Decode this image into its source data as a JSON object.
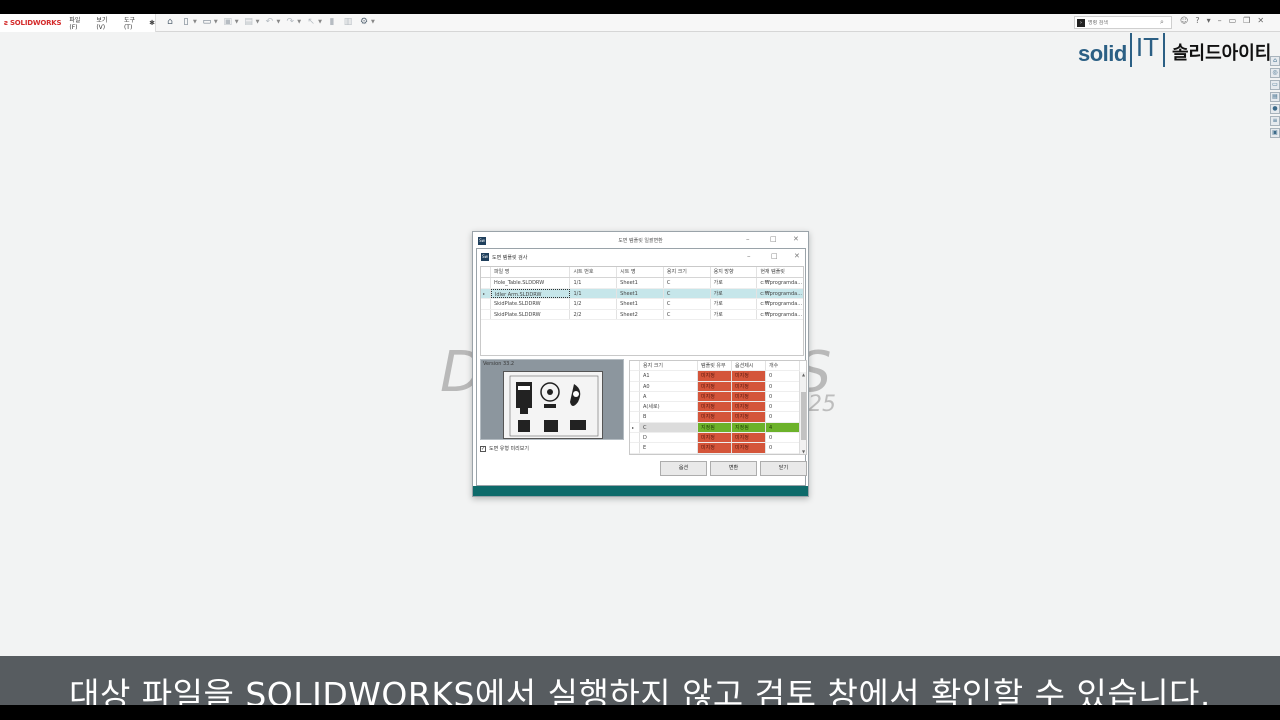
{
  "app": {
    "logo_text": "SOLIDWORKS",
    "menus": [
      "파일(F)",
      "보기(V)",
      "도구(T)"
    ],
    "search_placeholder": "명령 검색"
  },
  "brand": {
    "solid": "solid",
    "it": "IT",
    "korean": "솔리드아이티"
  },
  "background": {
    "mark_left": "D",
    "mark_right": "S",
    "year": "25"
  },
  "outer_dialog": {
    "title": "도면 템플릿 일괄변환"
  },
  "inner_dialog": {
    "title": "도면 템플릿 검사",
    "columns": [
      "파일 명",
      "시트 번호",
      "시트 명",
      "용지 크기",
      "용지 방향",
      "현재 템플릿"
    ],
    "rows": [
      [
        "Hole_Table.SLDDRW",
        "1/1",
        "Sheet1",
        "C",
        "가로",
        "c:₩programda..."
      ],
      [
        "Idler Arm.SLDDRW",
        "1/1",
        "Sheet1",
        "C",
        "가로",
        "c:₩programda..."
      ],
      [
        "SkidPlate.SLDDRW",
        "1/2",
        "Sheet1",
        "C",
        "가로",
        "c:₩programda..."
      ],
      [
        "SkidPlate.SLDDRW",
        "2/2",
        "Sheet2",
        "C",
        "가로",
        "c:₩programda..."
      ]
    ],
    "selected_row": 1,
    "preview_version": "Version 33.2",
    "preview_checkbox_label": "도면 유형 미리보기",
    "size_columns": [
      "용지 크기",
      "템플릿 유무",
      "옵션제시",
      "개수"
    ],
    "size_rows": [
      {
        "size": "A1",
        "template": "미지정",
        "option": "미지정",
        "count": "0",
        "status": "red"
      },
      {
        "size": "A0",
        "template": "미지정",
        "option": "미지정",
        "count": "0",
        "status": "red"
      },
      {
        "size": "A",
        "template": "미지정",
        "option": "미지정",
        "count": "0",
        "status": "red"
      },
      {
        "size": "A(세로)",
        "template": "미지정",
        "option": "미지정",
        "count": "0",
        "status": "red"
      },
      {
        "size": "B",
        "template": "미지정",
        "option": "미지정",
        "count": "0",
        "status": "red"
      },
      {
        "size": "C",
        "template": "지정됨",
        "option": "지정됨",
        "count": "4",
        "status": "green"
      },
      {
        "size": "D",
        "template": "미지정",
        "option": "미지정",
        "count": "0",
        "status": "red"
      },
      {
        "size": "E",
        "template": "미지정",
        "option": "미지정",
        "count": "0",
        "status": "red"
      }
    ],
    "selected_size_row": 5,
    "buttons": {
      "option": "옵션",
      "convert": "변환",
      "close": "닫기"
    }
  },
  "colors": {
    "missing": "#d4553a",
    "assigned": "#6cb22a",
    "footer": "#0e6a6a",
    "selection": "#c6e6ea"
  },
  "subtitle": "대상 파일을 SOLIDWORKS에서 실행하지 않고 검토 창에서 확인할 수 있습니다."
}
